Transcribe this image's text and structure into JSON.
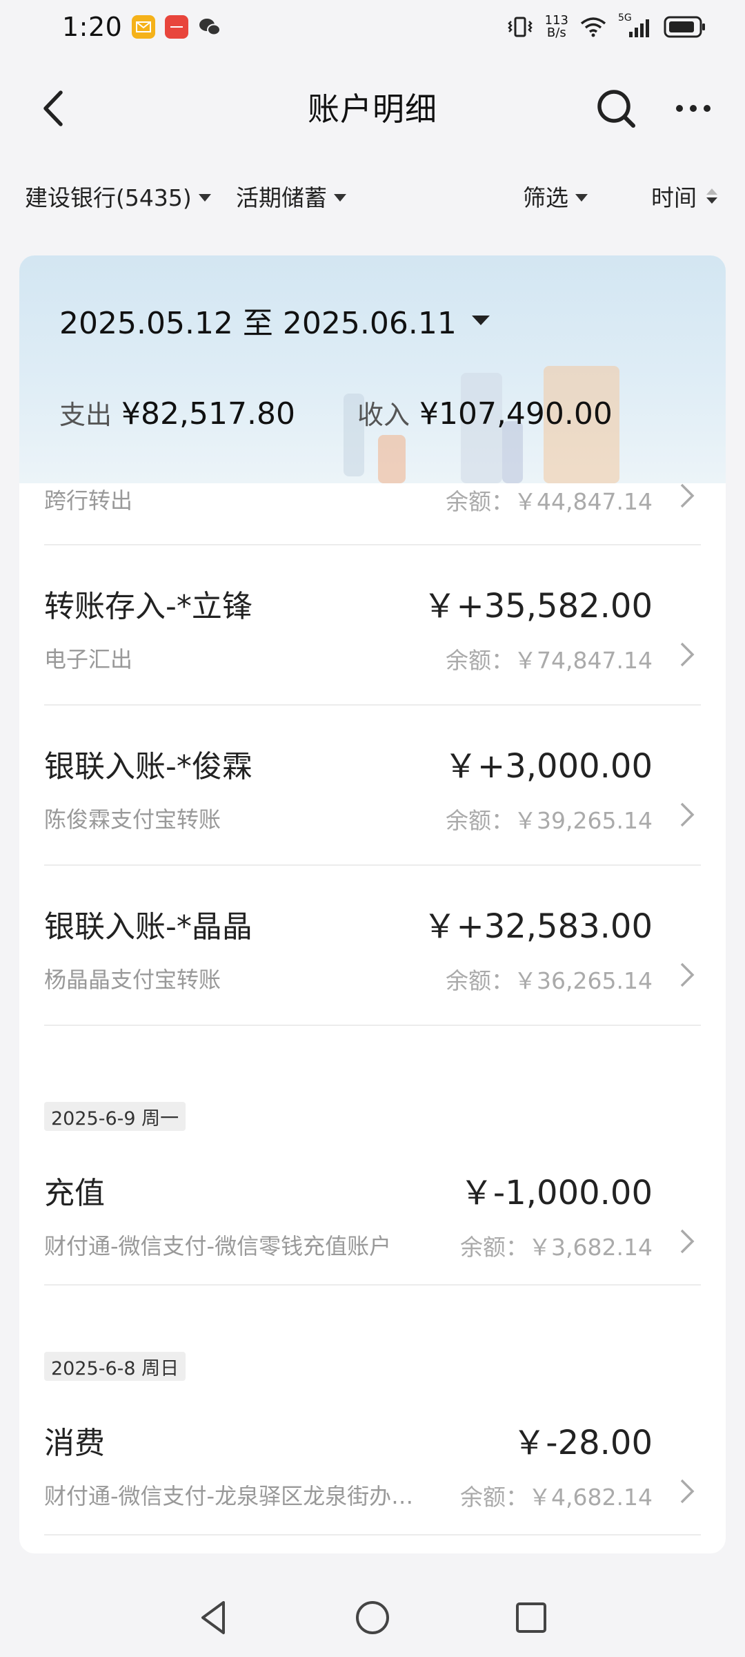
{
  "status_bar": {
    "time": "1:20",
    "net_speed_value": "113",
    "net_speed_unit": "B/s",
    "network": "5G"
  },
  "header": {
    "title": "账户明细"
  },
  "filters": {
    "bank": "建设银行(5435)",
    "account_type": "活期储蓄",
    "filter": "筛选",
    "sort": "时间"
  },
  "summary": {
    "date_range": "2025.05.12 至 2025.06.11",
    "expense_label": "支出",
    "expense_value": "¥82,517.80",
    "income_label": "收入",
    "income_value": "¥107,490.00"
  },
  "partial_row": {
    "desc": "跨行转出",
    "balance": "余额：￥44,847.14"
  },
  "transactions": [
    {
      "title": "转账存入-*立锋",
      "amount": "￥+35,582.00",
      "desc": "电子汇出",
      "balance": "余额：￥74,847.14"
    },
    {
      "title": "银联入账-*俊霖",
      "amount": "￥+3,000.00",
      "desc": "陈俊霖支付宝转账",
      "balance": "余额：￥39,265.14"
    },
    {
      "title": "银联入账-*晶晶",
      "amount": "￥+32,583.00",
      "desc": "杨晶晶支付宝转账",
      "balance": "余额：￥36,265.14"
    }
  ],
  "groups": [
    {
      "date": "2025-6-9 周一",
      "tx": {
        "title": "充值",
        "amount": "￥-1,000.00",
        "desc": "财付通-微信支付-微信零钱充值账户",
        "balance": "余额：￥3,682.14"
      }
    },
    {
      "date": "2025-6-8 周日",
      "tx": {
        "title": "消费",
        "amount": "￥-28.00",
        "desc": "财付通-微信支付-龙泉驿区龙泉街办…",
        "balance": "余额：￥4,682.14"
      }
    }
  ],
  "colors": {
    "background": "#f4f4f6",
    "card": "#ffffff",
    "summary_bg": "#d3e6f2",
    "secondary_text": "#999999"
  }
}
